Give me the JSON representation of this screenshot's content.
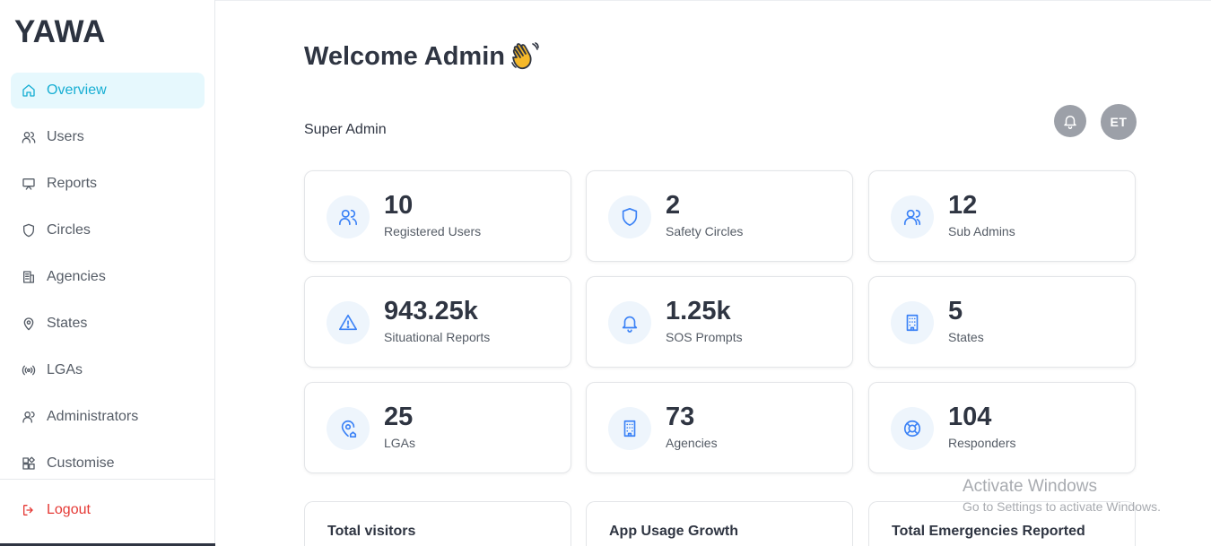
{
  "app": {
    "logo": "YAWA"
  },
  "sidebar": {
    "items": [
      {
        "label": "Overview",
        "icon": "home-icon",
        "active": true
      },
      {
        "label": "Users",
        "icon": "users-icon"
      },
      {
        "label": "Reports",
        "icon": "monitor-icon"
      },
      {
        "label": "Circles",
        "icon": "shield-icon"
      },
      {
        "label": "Agencies",
        "icon": "building-icon"
      },
      {
        "label": "States",
        "icon": "map-pin-icon"
      },
      {
        "label": "LGAs",
        "icon": "radio-icon"
      },
      {
        "label": "Administrators",
        "icon": "admin-users-icon"
      },
      {
        "label": "Customise",
        "icon": "widgets-icon"
      }
    ],
    "logout_label": "Logout"
  },
  "header": {
    "title": "Welcome Admin",
    "role": "Super Admin",
    "avatar_initials": "ET"
  },
  "stats": [
    {
      "value": "10",
      "label": "Registered Users",
      "icon": "users-icon"
    },
    {
      "value": "2",
      "label": "Safety Circles",
      "icon": "shield-icon"
    },
    {
      "value": "12",
      "label": "Sub Admins",
      "icon": "admin-users-icon"
    },
    {
      "value": "943.25k",
      "label": "Situational Reports",
      "icon": "alert-triangle-icon"
    },
    {
      "value": "1.25k",
      "label": "SOS Prompts",
      "icon": "bell-icon"
    },
    {
      "value": "5",
      "label": "States",
      "icon": "office-building-icon"
    },
    {
      "value": "25",
      "label": "LGAs",
      "icon": "map-pin-home-icon"
    },
    {
      "value": "73",
      "label": "Agencies",
      "icon": "office-building-icon"
    },
    {
      "value": "104",
      "label": "Responders",
      "icon": "life-buoy-icon"
    }
  ],
  "panels": [
    {
      "title": "Total visitors"
    },
    {
      "title": "App Usage Growth"
    },
    {
      "title": "Total Emergencies Reported"
    }
  ],
  "watermark": {
    "line1": "Activate Windows",
    "line2": "Go to Settings to activate Windows."
  },
  "colors": {
    "accent": "#16aed3",
    "active_bg": "#e6f8fd",
    "icon_blue": "#3b82f6",
    "icon_circle_bg": "#eef5fc",
    "logout_red": "#e53935",
    "avatar_gray": "#9ca0a8"
  }
}
